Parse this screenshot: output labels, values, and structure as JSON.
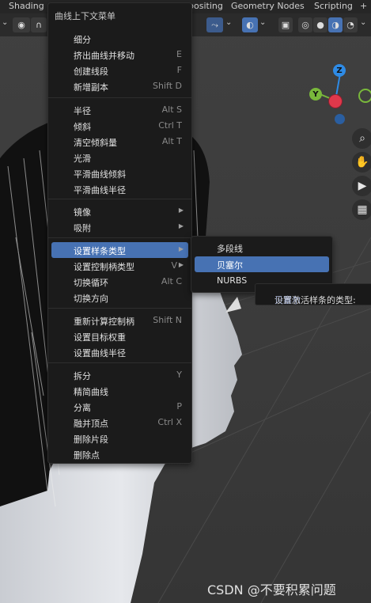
{
  "workspace_tabs": [
    "Shading",
    "positing",
    "Geometry Nodes",
    "Scripting",
    "+"
  ],
  "gizmo": {
    "z": "Z",
    "y": "Y"
  },
  "context_menu": {
    "title": "曲线上下文菜单",
    "groups": [
      [
        {
          "label": "细分",
          "shortcut": ""
        },
        {
          "label": "挤出曲线并移动",
          "shortcut": "E"
        },
        {
          "label": "创建线段",
          "shortcut": "F"
        },
        {
          "label": "新增副本",
          "shortcut": "Shift D"
        }
      ],
      [
        {
          "label": "半径",
          "shortcut": "Alt S"
        },
        {
          "label": "倾斜",
          "shortcut": "Ctrl T"
        },
        {
          "label": "清空倾斜量",
          "shortcut": "Alt T"
        },
        {
          "label": "光滑",
          "shortcut": ""
        },
        {
          "label": "平滑曲线倾斜",
          "shortcut": ""
        },
        {
          "label": "平滑曲线半径",
          "shortcut": ""
        }
      ],
      [
        {
          "label": "镜像",
          "shortcut": "",
          "submenu": true
        },
        {
          "label": "吸附",
          "shortcut": "",
          "submenu": true
        }
      ],
      [
        {
          "label": "设置样条类型",
          "shortcut": "",
          "submenu": true,
          "highlighted": true
        },
        {
          "label": "设置控制柄类型",
          "shortcut": "V",
          "submenu": true
        },
        {
          "label": "切换循环",
          "shortcut": "Alt C"
        },
        {
          "label": "切换方向",
          "shortcut": ""
        }
      ],
      [
        {
          "label": "重新计算控制柄",
          "shortcut": "Shift N"
        },
        {
          "label": "设置目标权重",
          "shortcut": ""
        },
        {
          "label": "设置曲线半径",
          "shortcut": ""
        }
      ],
      [
        {
          "label": "拆分",
          "shortcut": "Y"
        },
        {
          "label": "精简曲线",
          "shortcut": ""
        },
        {
          "label": "分离",
          "shortcut": "P"
        },
        {
          "label": "融并顶点",
          "shortcut": "Ctrl X"
        },
        {
          "label": "删除片段",
          "shortcut": ""
        },
        {
          "label": "删除点",
          "shortcut": ""
        }
      ]
    ]
  },
  "spline_submenu": {
    "items": [
      "多段线",
      "贝塞尔",
      "NURBS"
    ],
    "highlighted_index": 1
  },
  "tooltip": {
    "text": "设置激活样条的类型:",
    "value": "贝塞尔"
  },
  "watermark": "CSDN @不要积累问题",
  "colors": {
    "accent": "#4772b3",
    "menu_bg": "#1b1b1b",
    "axis_x": "#e0384b",
    "axis_y": "#79b83b",
    "axis_z": "#2e8be6"
  }
}
